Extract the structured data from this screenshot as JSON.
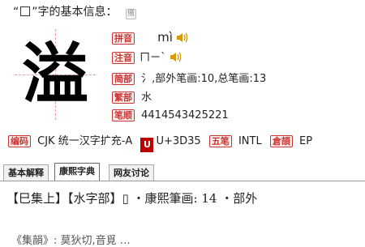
{
  "title": {
    "prefix": "“",
    "suffix": "”字的基本信息：",
    "stamp": "備"
  },
  "character": {
    "big": "溢",
    "big_box_char": "☐"
  },
  "info": [
    {
      "stamp": "拼音",
      "value": "mì",
      "audio": true
    },
    {
      "stamp": "注音",
      "value": "ㄇㄧˋ",
      "audio": true
    },
    {
      "stamp": "简部",
      "value": "氵,部外笔画:10,总笔画:13"
    },
    {
      "stamp": "繁部",
      "value": "水"
    },
    {
      "stamp": "笔顺",
      "value": "4414543425221"
    }
  ],
  "codes": {
    "encoding_stamp": "编码",
    "encoding_value": "CJK 统一汉字扩充-A",
    "unicode_logo": "U",
    "unicode_value": "U+3D35",
    "wubi_stamp": "五笔",
    "wubi_value": "INTL",
    "cangjie_stamp": "倉頡",
    "cangjie_value": "EP"
  },
  "tabs": [
    {
      "label": "基本解释",
      "active": false
    },
    {
      "label": "康熙字典",
      "active": true
    },
    {
      "label": "网友讨论",
      "active": false
    }
  ],
  "kangxi": {
    "line1": "【巳集上】【水字部】▯ ・康熙筆画: 14 ・部外",
    "line2": "《集韻》: 莫狄切,音覓 …"
  }
}
